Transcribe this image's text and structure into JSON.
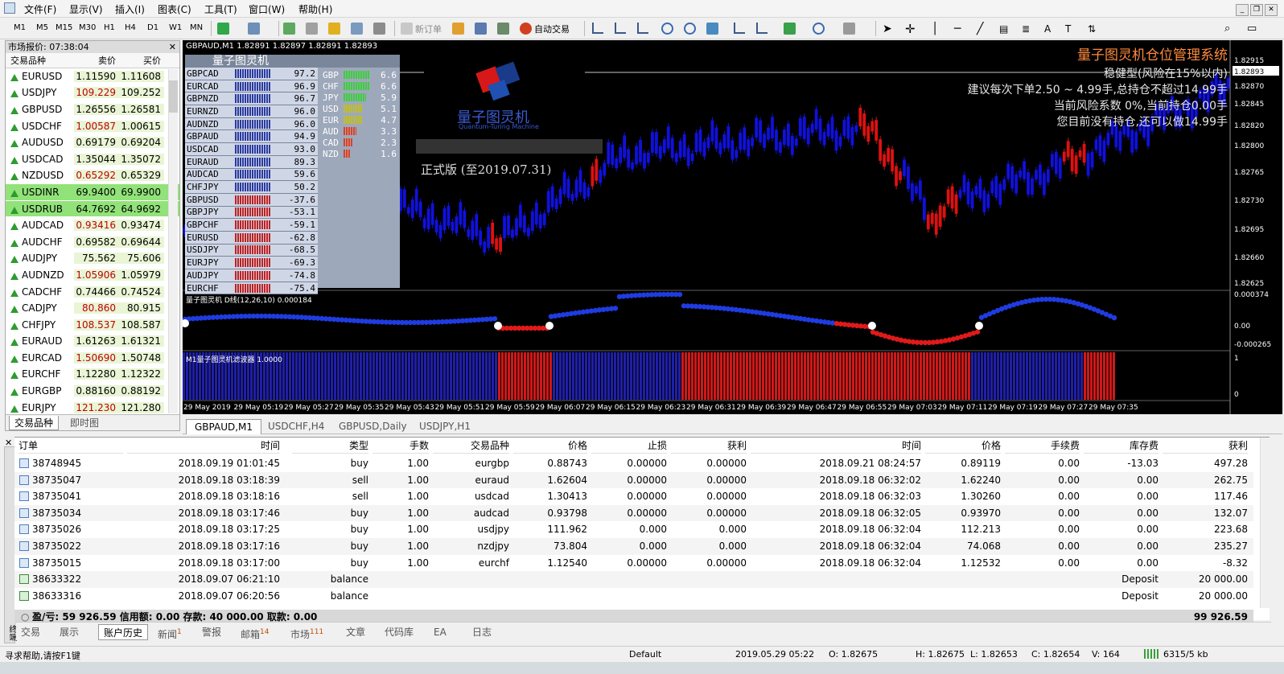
{
  "menu": [
    "文件(F)",
    "显示(V)",
    "插入(I)",
    "图表(C)",
    "工具(T)",
    "窗口(W)",
    "帮助(H)"
  ],
  "toolbar": {
    "timeframes": [
      "M1",
      "M5",
      "M15",
      "M30",
      "H1",
      "H4",
      "D1",
      "W1",
      "MN"
    ],
    "new_order": "新订单",
    "auto_trading": "自动交易"
  },
  "market_watch": {
    "title": "市场报价: 07:38:04",
    "headers": {
      "symbol": "交易品种",
      "bid": "卖价",
      "ask": "买价"
    },
    "rows": [
      {
        "symbol": "EURUSD",
        "bid": "1.11590",
        "ask": "1.11608",
        "dir": "up",
        "bid_color": "up"
      },
      {
        "symbol": "USDJPY",
        "bid": "109.229",
        "ask": "109.252",
        "dir": "up",
        "bid_color": "dn"
      },
      {
        "symbol": "GBPUSD",
        "bid": "1.26556",
        "ask": "1.26581",
        "dir": "up",
        "bid_color": "up"
      },
      {
        "symbol": "USDCHF",
        "bid": "1.00587",
        "ask": "1.00615",
        "dir": "up",
        "bid_color": "dn"
      },
      {
        "symbol": "AUDUSD",
        "bid": "0.69179",
        "ask": "0.69204",
        "dir": "up",
        "bid_color": "up"
      },
      {
        "symbol": "USDCAD",
        "bid": "1.35044",
        "ask": "1.35072",
        "dir": "up",
        "bid_color": "up"
      },
      {
        "symbol": "NZDUSD",
        "bid": "0.65292",
        "ask": "0.65329",
        "dir": "up",
        "bid_color": "dn"
      },
      {
        "symbol": "USDINR",
        "bid": "69.9400",
        "ask": "69.9900",
        "dir": "up",
        "bid_color": "up",
        "highlight": true
      },
      {
        "symbol": "USDRUB",
        "bid": "64.7692",
        "ask": "64.9692",
        "dir": "up",
        "bid_color": "up",
        "highlight": true
      },
      {
        "symbol": "AUDCAD",
        "bid": "0.93416",
        "ask": "0.93474",
        "dir": "up",
        "bid_color": "dn"
      },
      {
        "symbol": "AUDCHF",
        "bid": "0.69582",
        "ask": "0.69644",
        "dir": "up",
        "bid_color": "up"
      },
      {
        "symbol": "AUDJPY",
        "bid": "75.562",
        "ask": "75.606",
        "dir": "up",
        "bid_color": "up"
      },
      {
        "symbol": "AUDNZD",
        "bid": "1.05906",
        "ask": "1.05979",
        "dir": "up",
        "bid_color": "dn"
      },
      {
        "symbol": "CADCHF",
        "bid": "0.74466",
        "ask": "0.74524",
        "dir": "up",
        "bid_color": "up"
      },
      {
        "symbol": "CADJPY",
        "bid": "80.860",
        "ask": "80.915",
        "dir": "up",
        "bid_color": "dn"
      },
      {
        "symbol": "CHFJPY",
        "bid": "108.537",
        "ask": "108.587",
        "dir": "up",
        "bid_color": "dn"
      },
      {
        "symbol": "EURAUD",
        "bid": "1.61263",
        "ask": "1.61321",
        "dir": "up",
        "bid_color": "up"
      },
      {
        "symbol": "EURCAD",
        "bid": "1.50690",
        "ask": "1.50748",
        "dir": "up",
        "bid_color": "dn"
      },
      {
        "symbol": "EURCHF",
        "bid": "1.12280",
        "ask": "1.12322",
        "dir": "up",
        "bid_color": "up"
      },
      {
        "symbol": "EURGBP",
        "bid": "0.88160",
        "ask": "0.88192",
        "dir": "up",
        "bid_color": "up"
      },
      {
        "symbol": "EURJPY",
        "bid": "121.230",
        "ask": "121.280",
        "dir": "up",
        "bid_color": "dn"
      }
    ],
    "tabs": [
      "交易品种",
      "即时图"
    ]
  },
  "chart": {
    "header": "GBPAUD,M1  1.82891 1.82897 1.82891 1.82893",
    "panel_title": "量子图灵机",
    "pairs": [
      {
        "name": "GBPCAD",
        "val": "97.2",
        "pos": true
      },
      {
        "name": "EURCAD",
        "val": "96.9",
        "pos": true
      },
      {
        "name": "GBPNZD",
        "val": "96.7",
        "pos": true
      },
      {
        "name": "EURNZD",
        "val": "96.0",
        "pos": true
      },
      {
        "name": "AUDNZD",
        "val": "96.0",
        "pos": true
      },
      {
        "name": "GBPAUD",
        "val": "94.9",
        "pos": true
      },
      {
        "name": "USDCAD",
        "val": "93.0",
        "pos": true
      },
      {
        "name": "EURAUD",
        "val": "89.3",
        "pos": true
      },
      {
        "name": "AUDCAD",
        "val": "59.6",
        "pos": true
      },
      {
        "name": "CHFJPY",
        "val": "50.2",
        "pos": true
      },
      {
        "name": "GBPUSD",
        "val": "-37.6",
        "pos": false
      },
      {
        "name": "GBPJPY",
        "val": "-53.1",
        "pos": false
      },
      {
        "name": "GBPCHF",
        "val": "-59.1",
        "pos": false
      },
      {
        "name": "EURUSD",
        "val": "-62.8",
        "pos": false
      },
      {
        "name": "USDJPY",
        "val": "-68.5",
        "pos": false
      },
      {
        "name": "EURJPY",
        "val": "-69.3",
        "pos": false
      },
      {
        "name": "AUDJPY",
        "val": "-74.8",
        "pos": false
      },
      {
        "name": "EURCHF",
        "val": "-75.4",
        "pos": false
      }
    ],
    "currencies": [
      {
        "name": "GBP",
        "val": "6.6",
        "strength": 0.66
      },
      {
        "name": "CHF",
        "val": "6.6",
        "strength": 0.66
      },
      {
        "name": "JPY",
        "val": "5.9",
        "strength": 0.59
      },
      {
        "name": "USD",
        "val": "5.1",
        "strength": 0.51
      },
      {
        "name": "EUR",
        "val": "4.7",
        "strength": 0.47
      },
      {
        "name": "AUD",
        "val": "3.3",
        "strength": 0.33
      },
      {
        "name": "CAD",
        "val": "2.3",
        "strength": 0.23
      },
      {
        "name": "NZD",
        "val": "1.6",
        "strength": 0.16
      }
    ],
    "logo_cn": "量子图灵机",
    "logo_en": "Quantum-Turing Machine",
    "version": "正式版 (至2019.07.31)",
    "system_title": "量子图灵机仓位管理系统",
    "risk_lines": [
      "稳健型(风险在15%以内)",
      "建议每次下单2.50 ~ 4.99手,总持仓不超过14.99手",
      "当前风险系数  0%,当前持仓0.00手",
      "您目前没有持仓,还可以做14.99手"
    ],
    "prices": [
      "1.82915",
      "1.82893",
      "1.82870",
      "1.82845",
      "1.82820",
      "1.82800",
      "1.82765",
      "1.82730",
      "1.82695",
      "1.82660",
      "1.82625"
    ],
    "current_price": "1.82893",
    "osc_title": "量子图灵机 D线(12,26,10) 0.000184",
    "osc_scale": [
      "0.000374",
      "0.00",
      "-0.000265"
    ],
    "filter_title": "M1量子图灵机滤波器 1.0000",
    "filter_scale": [
      "1",
      "0"
    ],
    "times": [
      "29 May 2019",
      "29 May 05:19",
      "29 May 05:27",
      "29 May 05:35",
      "29 May 05:43",
      "29 May 05:51",
      "29 May 05:59",
      "29 May 06:07",
      "29 May 06:15",
      "29 May 06:23",
      "29 May 06:31",
      "29 May 06:39",
      "29 May 06:47",
      "29 May 06:55",
      "29 May 07:03",
      "29 May 07:11",
      "29 May 07:19",
      "29 May 07:27",
      "29 May 07:35"
    ],
    "colors": {
      "bull": "#1010e0",
      "bear": "#e01010",
      "osc_pos": "#1f3ce0",
      "osc_neg": "#e01a1a",
      "title": "#ff8a3c"
    }
  },
  "chart_tabs": [
    "GBPAUD,M1",
    "USDCHF,H4",
    "GBPUSD,Daily",
    "USDJPY,H1"
  ],
  "terminal": {
    "headers": [
      "订单",
      "时间",
      "类型",
      "手数",
      "交易品种",
      "价格",
      "止损",
      "获利",
      "时间",
      "价格",
      "手续费",
      "库存费",
      "获利"
    ],
    "rows": [
      {
        "order": "38748945",
        "open_time": "2018.09.19 01:01:45",
        "type": "buy",
        "lots": "1.00",
        "symbol": "eurgbp",
        "price": "0.88743",
        "sl": "0.00000",
        "tp": "0.00000",
        "close_time": "2018.09.21 08:24:57",
        "close_price": "0.89119",
        "commission": "0.00",
        "swap": "-13.03",
        "profit": "497.28"
      },
      {
        "order": "38735047",
        "open_time": "2018.09.18 03:18:39",
        "type": "sell",
        "lots": "1.00",
        "symbol": "euraud",
        "price": "1.62604",
        "sl": "0.00000",
        "tp": "0.00000",
        "close_time": "2018.09.18 06:32:02",
        "close_price": "1.62240",
        "commission": "0.00",
        "swap": "0.00",
        "profit": "262.75"
      },
      {
        "order": "38735041",
        "open_time": "2018.09.18 03:18:16",
        "type": "sell",
        "lots": "1.00",
        "symbol": "usdcad",
        "price": "1.30413",
        "sl": "0.00000",
        "tp": "0.00000",
        "close_time": "2018.09.18 06:32:03",
        "close_price": "1.30260",
        "commission": "0.00",
        "swap": "0.00",
        "profit": "117.46"
      },
      {
        "order": "38735034",
        "open_time": "2018.09.18 03:17:46",
        "type": "buy",
        "lots": "1.00",
        "symbol": "audcad",
        "price": "0.93798",
        "sl": "0.00000",
        "tp": "0.00000",
        "close_time": "2018.09.18 06:32:05",
        "close_price": "0.93970",
        "commission": "0.00",
        "swap": "0.00",
        "profit": "132.07"
      },
      {
        "order": "38735026",
        "open_time": "2018.09.18 03:17:25",
        "type": "buy",
        "lots": "1.00",
        "symbol": "usdjpy",
        "price": "111.962",
        "sl": "0.000",
        "tp": "0.000",
        "close_time": "2018.09.18 06:32:04",
        "close_price": "112.213",
        "commission": "0.00",
        "swap": "0.00",
        "profit": "223.68"
      },
      {
        "order": "38735022",
        "open_time": "2018.09.18 03:17:16",
        "type": "buy",
        "lots": "1.00",
        "symbol": "nzdjpy",
        "price": "73.804",
        "sl": "0.000",
        "tp": "0.000",
        "close_time": "2018.09.18 06:32:04",
        "close_price": "74.068",
        "commission": "0.00",
        "swap": "0.00",
        "profit": "235.27"
      },
      {
        "order": "38735015",
        "open_time": "2018.09.18 03:17:00",
        "type": "buy",
        "lots": "1.00",
        "symbol": "eurchf",
        "price": "1.12540",
        "sl": "0.00000",
        "tp": "0.00000",
        "close_time": "2018.09.18 06:32:04",
        "close_price": "1.12532",
        "commission": "0.00",
        "swap": "0.00",
        "profit": "-8.32"
      },
      {
        "order": "38633322",
        "open_time": "2018.09.07 06:21:10",
        "type": "balance",
        "balance": true,
        "comment": "Deposit",
        "profit": "20 000.00"
      },
      {
        "order": "38633316",
        "open_time": "2018.09.07 06:20:56",
        "type": "balance",
        "balance": true,
        "comment": "Deposit",
        "profit": "20 000.00"
      }
    ],
    "summary": "盈/亏: 59 926.59  信用额: 0.00  存款: 40 000.00  取款: 0.00",
    "total": "99 926.59",
    "tabs": [
      {
        "label": "交易"
      },
      {
        "label": "展示"
      },
      {
        "label": "账户历史",
        "active": true
      },
      {
        "label": "新闻",
        "badge": "1"
      },
      {
        "label": "警报"
      },
      {
        "label": "邮箱",
        "badge": "14"
      },
      {
        "label": "市场",
        "badge": "111"
      },
      {
        "label": "文章"
      },
      {
        "label": "代码库"
      },
      {
        "label": "EA"
      },
      {
        "label": "日志"
      }
    ],
    "side_label": "终端"
  },
  "status": {
    "help": "寻求帮助,请按F1键",
    "profile": "Default",
    "time": "2019.05.29 05:22",
    "open": "O: 1.82675",
    "high": "H: 1.82675",
    "low": "L: 1.82653",
    "close": "C: 1.82654",
    "volume": "V: 164",
    "traffic": "6315/5 kb"
  }
}
